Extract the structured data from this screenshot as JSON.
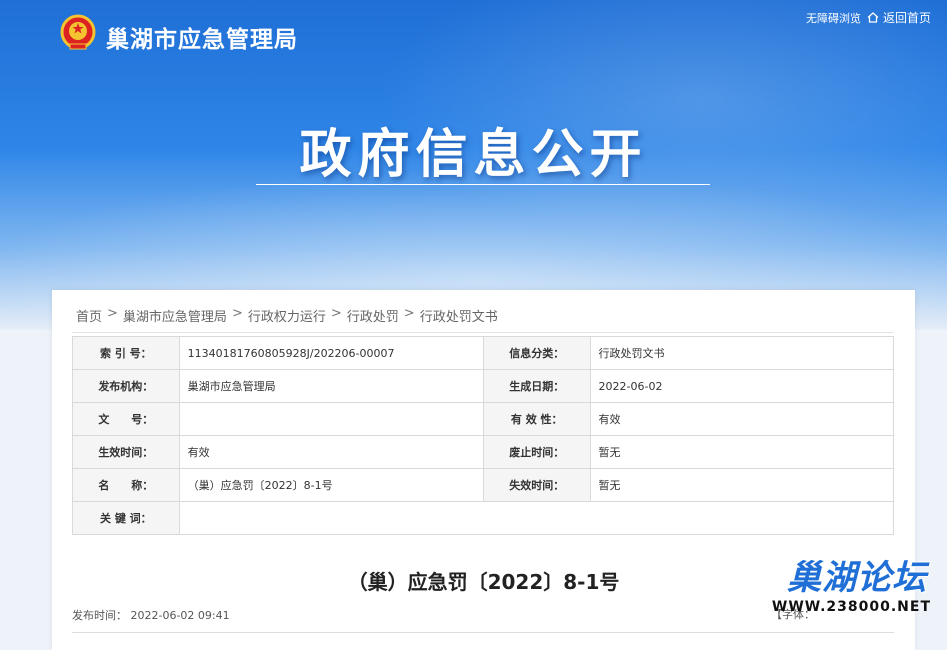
{
  "header": {
    "site_name": "巢湖市应急管理局",
    "accessibility_label": "无障碍浏览",
    "home_link": "返回首页"
  },
  "banner": {
    "title": "政府信息公开"
  },
  "breadcrumb": [
    "首页",
    "巢湖市应急管理局",
    "行政权力运行",
    "行政处罚",
    "行政处罚文书"
  ],
  "breadcrumb_sep": ">",
  "info_table": {
    "rows": [
      [
        {
          "k": "索 引 号：",
          "v": "11340181760805928J/202206-00007"
        },
        {
          "k": "信息分类：",
          "v": "行政处罚文书"
        }
      ],
      [
        {
          "k": "发布机构：",
          "v": "巢湖市应急管理局"
        },
        {
          "k": "生成日期：",
          "v": "2022-06-02"
        }
      ],
      [
        {
          "k": "文　　号：",
          "v": ""
        },
        {
          "k": "有 效 性：",
          "v": "有效"
        }
      ],
      [
        {
          "k": "生效时间：",
          "v": "有效"
        },
        {
          "k": "废止时间：",
          "v": "暂无"
        }
      ],
      [
        {
          "k": "名　　称：",
          "v": "（巢）应急罚〔2022〕8-1号"
        },
        {
          "k": "失效时间：",
          "v": "暂无"
        }
      ],
      [
        {
          "k": "关 键 词：",
          "v": ""
        }
      ]
    ]
  },
  "document": {
    "title": "（巢）应急罚〔2022〕8-1号",
    "publish_label": "发布时间：",
    "publish_time": "2022-06-02 09:41",
    "font_label": "【字体："
  },
  "watermark": {
    "brand": "巢湖论坛",
    "url": "WWW.238000.NET"
  },
  "colors": {
    "banner_blue": "#1f6fd6",
    "panel_bg": "#ffffff"
  }
}
